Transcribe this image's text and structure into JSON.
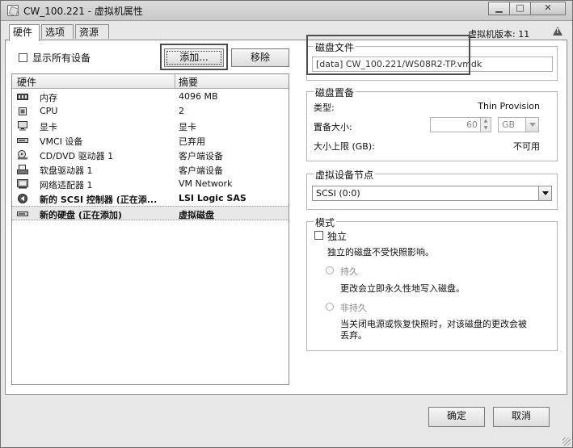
{
  "window": {
    "title": "CW_100.221 - 虚拟机属性",
    "controls": {
      "minimize": "▁",
      "maximize": "□",
      "close": "✕"
    }
  },
  "tabs": [
    {
      "label": "硬件",
      "active": true
    },
    {
      "label": "选项",
      "active": false
    },
    {
      "label": "资源",
      "active": false
    }
  ],
  "vm_version": "虚拟机版本: 11",
  "hardware": {
    "show_all_devices": {
      "label": "显示所有设备",
      "checked": false
    },
    "add_button": "添加...",
    "remove_button": "移除",
    "columns": {
      "name": "硬件",
      "summary": "摘要"
    },
    "rows": [
      {
        "icon": "memory-icon",
        "name": "内存",
        "summary": "4096 MB",
        "bold": false
      },
      {
        "icon": "cpu-icon",
        "name": "CPU",
        "summary": "2",
        "bold": false
      },
      {
        "icon": "display-icon",
        "name": "显卡",
        "summary": "显卡",
        "bold": false
      },
      {
        "icon": "vmci-icon",
        "name": "VMCI 设备",
        "summary": "已弃用",
        "bold": false
      },
      {
        "icon": "cd-dvd-icon",
        "name": "CD/DVD 驱动器 1",
        "summary": "客户端设备",
        "bold": false
      },
      {
        "icon": "floppy-icon",
        "name": "软盘驱动器 1",
        "summary": "客户端设备",
        "bold": false
      },
      {
        "icon": "network-adapter-icon",
        "name": "网络适配器 1",
        "summary": "VM Network",
        "bold": false
      },
      {
        "icon": "scsi-controller-icon",
        "name": "新的 SCSI 控制器 (正在添...",
        "summary": "LSI Logic SAS",
        "bold": true
      },
      {
        "icon": "hard-disk-icon",
        "name": "新的硬盘 (正在添加)",
        "summary": "虚拟磁盘",
        "bold": true,
        "selected": true
      }
    ]
  },
  "disk_file": {
    "title": "磁盘文件",
    "value": "[data] CW_100.221/WS08R2-TP.vmdk"
  },
  "disk_provision": {
    "title": "磁盘置备",
    "type_label": "类型:",
    "type_value": "Thin Provision",
    "size_label": "置备大小:",
    "size_value": "60",
    "size_unit": "GB",
    "max_label": "大小上限 (GB):",
    "max_value": "不可用"
  },
  "virtual_device_node": {
    "title": "虚拟设备节点",
    "value": "SCSI (0:0)"
  },
  "mode": {
    "title": "模式",
    "independent_label": "独立",
    "independent_checked": false,
    "independent_desc": "独立的磁盘不受快照影响。",
    "persistent_label": "持久",
    "persistent_desc": "更改会立即永久性地写入磁盘。",
    "nonpersistent_label": "非持久",
    "nonpersistent_desc_1": "当关闭电源或恢复快照时，对该磁盘的更改会被",
    "nonpersistent_desc_2": "丢弃。"
  },
  "footer": {
    "ok_button": "确定",
    "cancel_button": "取消"
  }
}
